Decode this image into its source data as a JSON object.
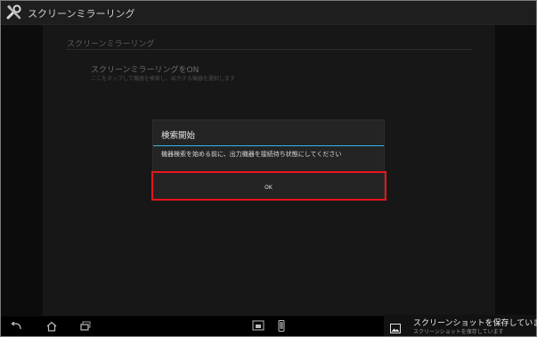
{
  "app": {
    "title": "スクリーンミラーリング"
  },
  "settings": {
    "section_header": "スクリーンミラーリング",
    "pref_title": "スクリーンミラーリングをON",
    "pref_summary": "ここをタップして機器を検索し、出力する機器を選択します"
  },
  "dialog": {
    "title": "検索開始",
    "message": "機器検索を始める前に、出力機器を接続待ち状態にしてください",
    "ok_label": "OK"
  },
  "notification": {
    "title": "スクリーンショットを保存していま",
    "subtitle": "スクリーンショットを保存しています"
  },
  "nav": {
    "icons": [
      "back-icon",
      "home-icon",
      "recent-apps-icon",
      "small-app-icon",
      "phone-icon",
      "screenshot-icon"
    ]
  },
  "colors": {
    "accent": "#33b5e5",
    "highlight": "#e8141b",
    "dialog_bg": "#242424",
    "background": "#0c0c0c"
  }
}
